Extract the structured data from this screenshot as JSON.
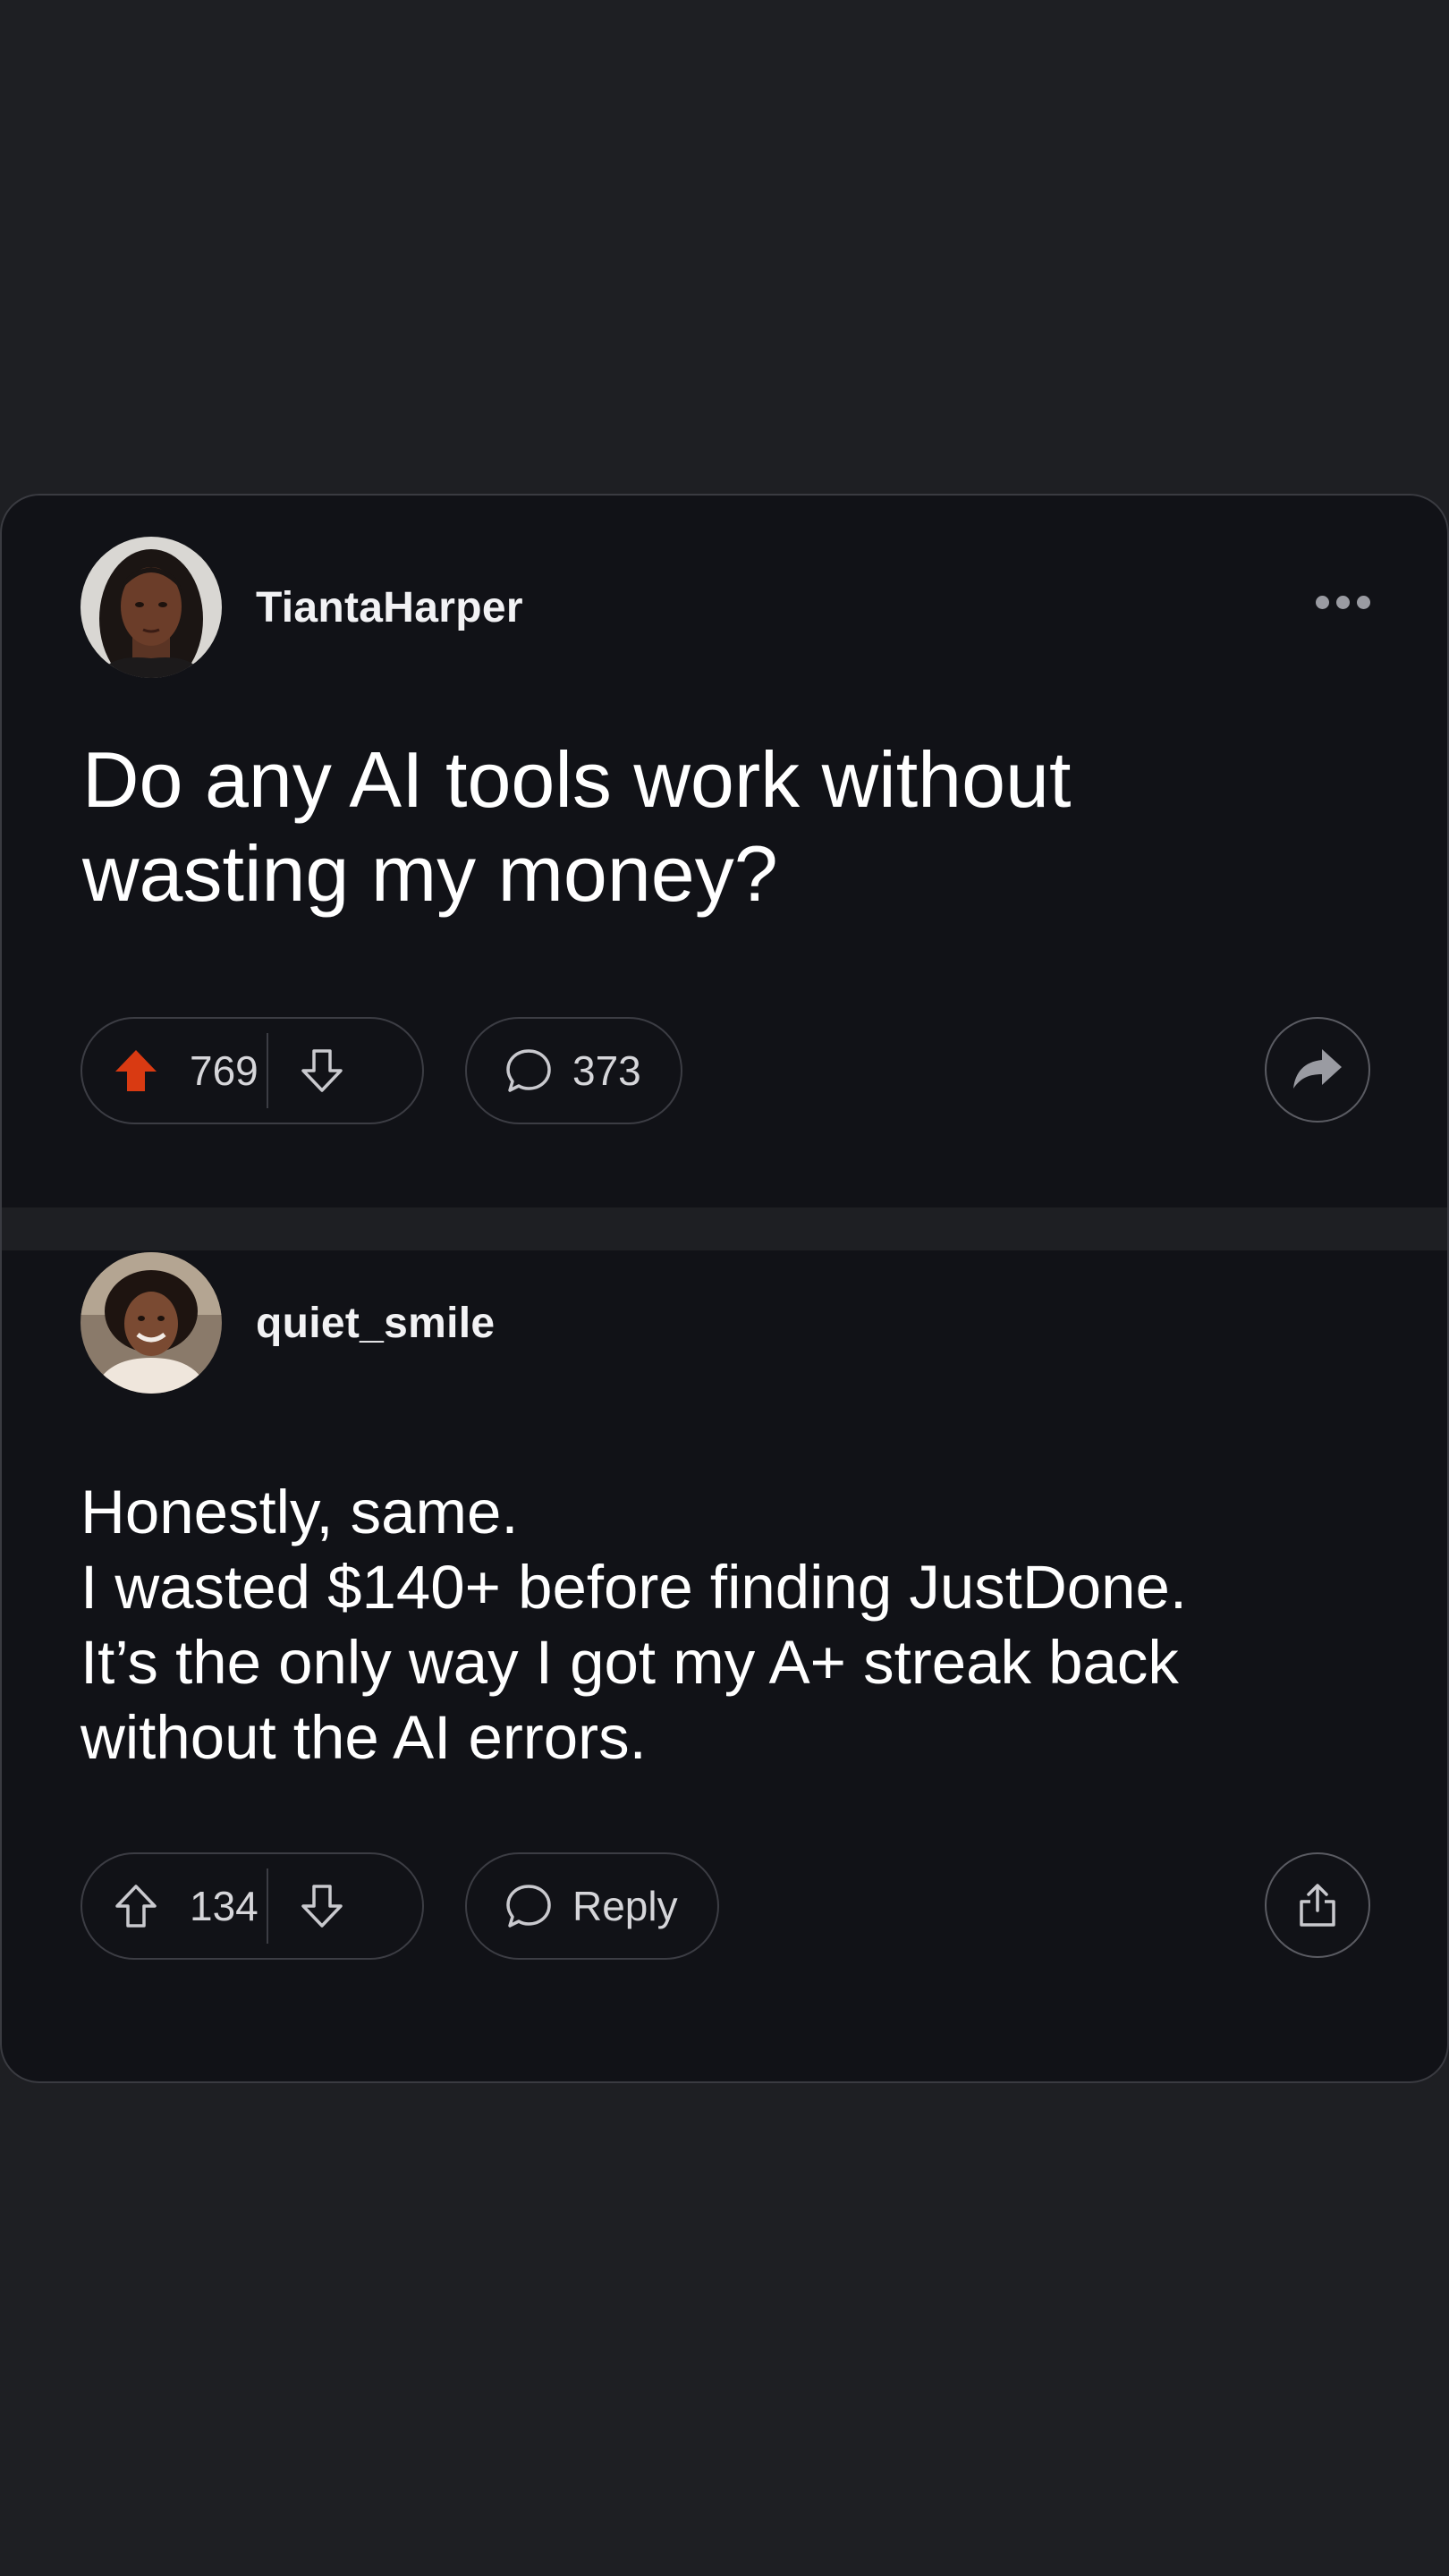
{
  "post": {
    "author": "TiantaHarper",
    "title": "Do any AI tools work without wasting my money?",
    "upvotes": "769",
    "comments": "373",
    "upvoted": true
  },
  "comment": {
    "author": "quiet_smile",
    "lines": [
      "Honestly, same.",
      "I wasted $140+ before finding JustDone.",
      "It’s the only way I got my A+ streak back",
      "without the AI errors."
    ],
    "upvotes": "134",
    "reply_label": "Reply"
  },
  "colors": {
    "background": "#1e1f23",
    "card": "#111217",
    "upvote_active": "#d93a12",
    "text": "#ffffff"
  },
  "icons": [
    "more-icon",
    "upvote-icon",
    "downvote-icon",
    "comment-icon",
    "share-icon"
  ]
}
